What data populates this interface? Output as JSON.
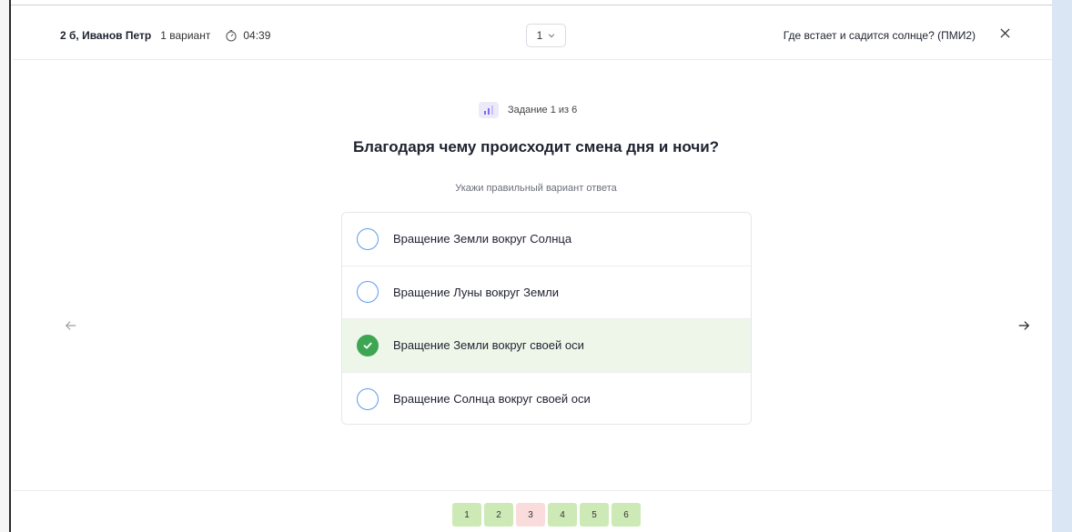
{
  "header": {
    "user_name": "2 б, Иванов Петр",
    "variant": "1 вариант",
    "timer": "04:39",
    "task_select_value": "1",
    "test_title": "Где встает и садится солнце? (ПМИ2)"
  },
  "task": {
    "counter": "Задание 1 из 6",
    "question": "Благодаря чему происходит смена дня и ночи?",
    "instruction": "Укажи правильный вариант ответа",
    "options": [
      {
        "label": "Вращение Земли вокруг Солнца",
        "selected": false
      },
      {
        "label": "Вращение Луны вокруг Земли",
        "selected": false
      },
      {
        "label": "Вращение Земли вокруг своей оси",
        "selected": true
      },
      {
        "label": "Вращение Солнца вокруг своей оси",
        "selected": false
      }
    ]
  },
  "pages": [
    {
      "label": "1",
      "status": "green"
    },
    {
      "label": "2",
      "status": "green"
    },
    {
      "label": "3",
      "status": "red"
    },
    {
      "label": "4",
      "status": "green"
    },
    {
      "label": "5",
      "status": "green"
    },
    {
      "label": "6",
      "status": "green"
    }
  ],
  "colors": {
    "accent_green": "#3ea652",
    "radio_blue": "#5a9de8",
    "page_green": "#cdeab6",
    "page_red": "#fbdcdc",
    "selected_row": "#eef6ea"
  },
  "icons": {
    "timer": "stopwatch-icon",
    "select_chevron": "chevron-down-icon",
    "close": "close-icon",
    "level": "difficulty-bars-icon",
    "check": "check-icon",
    "prev": "arrow-left-icon",
    "next": "arrow-right-icon"
  }
}
